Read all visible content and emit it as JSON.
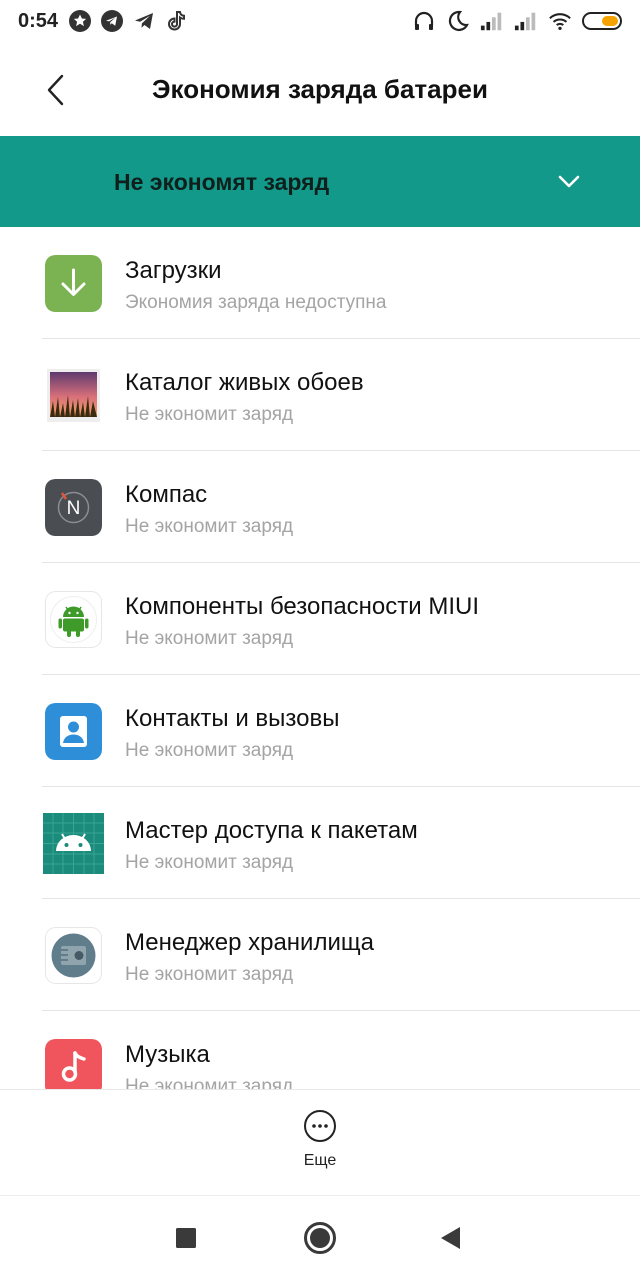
{
  "status_bar": {
    "time": "0:54",
    "left_icons": [
      "star-notification-icon",
      "telegram-icon",
      "telegram-icon",
      "tiktok-icon"
    ],
    "right_icons": [
      "headphones-icon",
      "moon-icon",
      "signal-icon",
      "signal-icon",
      "wifi-icon",
      "battery-icon"
    ],
    "battery_color": "#f4a300"
  },
  "header": {
    "title": "Экономия заряда батареи",
    "back_icon": "chevron-left-icon"
  },
  "filter": {
    "label": "Не экономят заряд",
    "bg_color": "#12998a",
    "icon": "chevron-down-icon"
  },
  "apps": [
    {
      "name": "Загрузки",
      "status": "Экономия заряда недоступна",
      "icon": "downloads-icon"
    },
    {
      "name": "Каталог живых обоев",
      "status": "Не экономит заряд",
      "icon": "live-wallpaper-icon"
    },
    {
      "name": "Компас",
      "status": "Не экономит заряд",
      "icon": "compass-icon"
    },
    {
      "name": "Компоненты безопасности MIUI",
      "status": "Не экономит заряд",
      "icon": "android-security-icon"
    },
    {
      "name": "Контакты и вызовы",
      "status": "Не экономит заряд",
      "icon": "contacts-icon"
    },
    {
      "name": "Мастер доступа к пакетам",
      "status": "Не экономит заряд",
      "icon": "package-access-icon"
    },
    {
      "name": "Менеджер хранилища",
      "status": "Не экономит заряд",
      "icon": "storage-manager-icon"
    },
    {
      "name": "Музыка",
      "status": "Не экономит заряд",
      "icon": "music-icon"
    }
  ],
  "bottom": {
    "more_label": "Еще",
    "more_icon": "more-dots-icon"
  },
  "nav": {
    "icons": [
      "recents-square-icon",
      "home-circle-icon",
      "back-triangle-icon"
    ]
  }
}
